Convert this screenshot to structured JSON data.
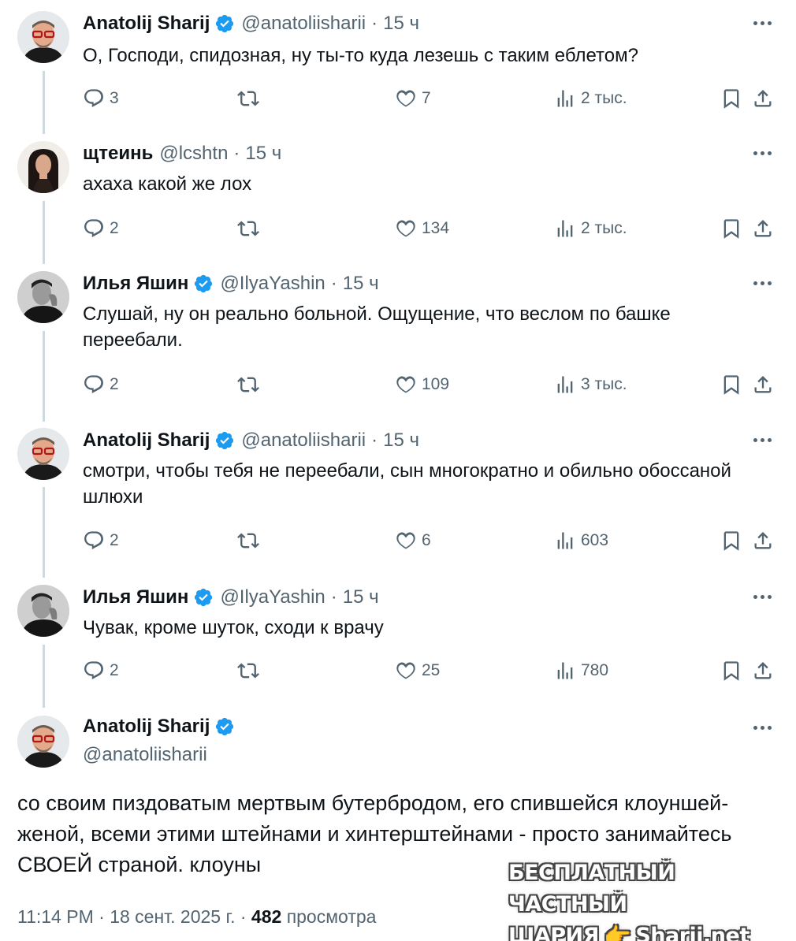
{
  "tweets": [
    {
      "name": "Anatolij Sharij",
      "verified": true,
      "handle": "@anatoliisharii",
      "time": "15 ч",
      "text": "О, Господи, спидозная, ну ты-то куда лезешь с таким еблетом?",
      "replies": "3",
      "retweets": "",
      "likes": "7",
      "views": "2 тыс."
    },
    {
      "name": "щтеинь",
      "verified": false,
      "handle": "@lcshtn",
      "time": "15 ч",
      "text": "ахаха какой же лох",
      "replies": "2",
      "retweets": "",
      "likes": "134",
      "views": "2 тыс."
    },
    {
      "name": "Илья Яшин",
      "verified": true,
      "handle": "@IlyaYashin",
      "time": "15 ч",
      "text": "Слушай, ну он реально больной. Ощущение, что веслом по башке переебали.",
      "replies": "2",
      "retweets": "",
      "likes": "109",
      "views": "3 тыс."
    },
    {
      "name": "Anatolij Sharij",
      "verified": true,
      "handle": "@anatoliisharii",
      "time": "15 ч",
      "text": "смотри, чтобы тебя не переебали, сын многократно и обильно обоссаной шлюхи",
      "replies": "2",
      "retweets": "",
      "likes": "6",
      "views": "603"
    },
    {
      "name": "Илья Яшин",
      "verified": true,
      "handle": "@IlyaYashin",
      "time": "15 ч",
      "text": "Чувак, кроме шуток, сходи к врачу",
      "replies": "2",
      "retweets": "",
      "likes": "25",
      "views": "780"
    }
  ],
  "separator": "·",
  "main": {
    "name": "Anatolij Sharij",
    "handle": "@anatoliisharii",
    "text": "со своим пиздоватым мертвым бутербродом, его спившейся клоуншей-женой, всеми этими штейнами и хинтерштейнами - просто занимайтесь СВОЕЙ страной. клоуны",
    "time": "11:14 PM",
    "date": "18 сент. 2025 г.",
    "views_count": "482",
    "views_label": "просмотра"
  },
  "watermark": {
    "line1": "БЕСПЛАТНЫЙ ЧАСТНЫЙ",
    "line2a": "ШАРИЯ",
    "hand": "👉",
    "line2b": "Sharij.net"
  },
  "colors": {
    "verified_badge": "#1d9bf0",
    "secondary_text": "#536471",
    "thread_line": "#cfd9de"
  }
}
